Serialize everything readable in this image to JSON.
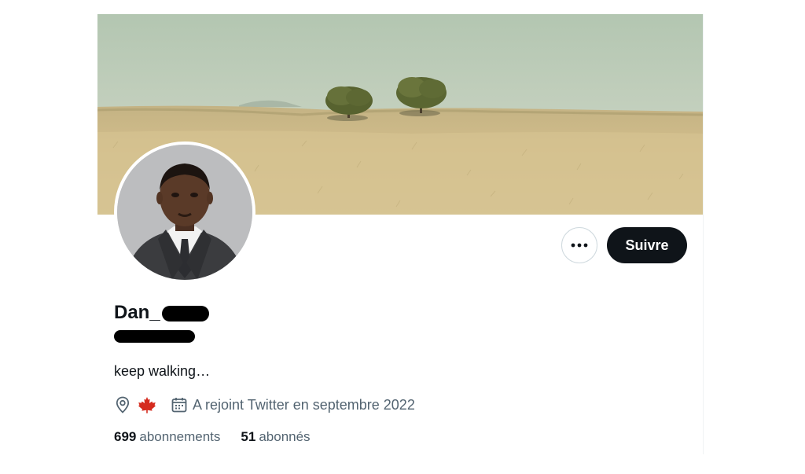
{
  "profile": {
    "display_name": "Dan_",
    "bio": "keep walking…",
    "joined": "A rejoint Twitter en septembre 2022",
    "location_flag": "canada-flag-icon"
  },
  "actions": {
    "follow_label": "Suivre",
    "more_label": "•••"
  },
  "stats": {
    "following_count": "699",
    "following_label": "abonnements",
    "followers_count": "51",
    "followers_label": "abonnés"
  },
  "colors": {
    "follow_button_bg": "#0f1419",
    "text_primary": "#0f1419",
    "text_secondary": "#536471",
    "flag_red": "#d52b1e"
  }
}
